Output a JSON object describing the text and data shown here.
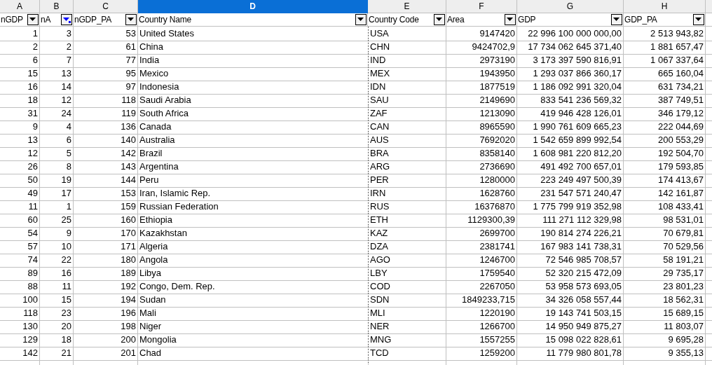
{
  "column_letters": [
    {
      "label": "A",
      "selected": false
    },
    {
      "label": "B",
      "selected": false
    },
    {
      "label": "C",
      "selected": false
    },
    {
      "label": "D",
      "selected": true
    },
    {
      "label": "E",
      "selected": false
    },
    {
      "label": "F",
      "selected": false
    },
    {
      "label": "G",
      "selected": false
    },
    {
      "label": "H",
      "selected": false
    }
  ],
  "header_row": [
    {
      "label": "nGDP",
      "filter_active": false,
      "kind": "number"
    },
    {
      "label": "nA",
      "filter_active": true,
      "kind": "number"
    },
    {
      "label": "nGDP_PA",
      "filter_active": false,
      "kind": "number"
    },
    {
      "label": "Country Name",
      "filter_active": false,
      "kind": "text"
    },
    {
      "label": "Country Code",
      "filter_active": false,
      "kind": "text"
    },
    {
      "label": "Area",
      "filter_active": false,
      "kind": "number"
    },
    {
      "label": "GDP",
      "filter_active": false,
      "kind": "number"
    },
    {
      "label": "GDP_PA",
      "filter_active": false,
      "kind": "number"
    }
  ],
  "rows": [
    [
      "1",
      "3",
      "53",
      "United States",
      "USA",
      "9147420",
      "22 996 100 000 000,00",
      "2 513 943,82"
    ],
    [
      "2",
      "2",
      "61",
      "China",
      "CHN",
      "9424702,9",
      "17 734 062 645 371,40",
      "1 881 657,47"
    ],
    [
      "6",
      "7",
      "77",
      "India",
      "IND",
      "2973190",
      "3 173 397 590 816,91",
      "1 067 337,64"
    ],
    [
      "15",
      "13",
      "95",
      "Mexico",
      "MEX",
      "1943950",
      "1 293 037 866 360,17",
      "665 160,04"
    ],
    [
      "16",
      "14",
      "97",
      "Indonesia",
      "IDN",
      "1877519",
      "1 186 092 991 320,04",
      "631 734,21"
    ],
    [
      "18",
      "12",
      "118",
      "Saudi Arabia",
      "SAU",
      "2149690",
      "833 541 236 569,32",
      "387 749,51"
    ],
    [
      "31",
      "24",
      "119",
      "South Africa",
      "ZAF",
      "1213090",
      "419 946 428 126,01",
      "346 179,12"
    ],
    [
      "9",
      "4",
      "136",
      "Canada",
      "CAN",
      "8965590",
      "1 990 761 609 665,23",
      "222 044,69"
    ],
    [
      "13",
      "6",
      "140",
      "Australia",
      "AUS",
      "7692020",
      "1 542 659 899 992,54",
      "200 553,29"
    ],
    [
      "12",
      "5",
      "142",
      "Brazil",
      "BRA",
      "8358140",
      "1 608 981 220 812,20",
      "192 504,70"
    ],
    [
      "26",
      "8",
      "143",
      "Argentina",
      "ARG",
      "2736690",
      "491 492 700 657,01",
      "179 593,85"
    ],
    [
      "50",
      "19",
      "144",
      "Peru",
      "PER",
      "1280000",
      "223 249 497 500,39",
      "174 413,67"
    ],
    [
      "49",
      "17",
      "153",
      "Iran, Islamic Rep.",
      "IRN",
      "1628760",
      "231 547 571 240,47",
      "142 161,87"
    ],
    [
      "11",
      "1",
      "159",
      "Russian Federation",
      "RUS",
      "16376870",
      "1 775 799 919 352,98",
      "108 433,41"
    ],
    [
      "60",
      "25",
      "160",
      "Ethiopia",
      "ETH",
      "1129300,39",
      "111 271 112 329,98",
      "98 531,01"
    ],
    [
      "54",
      "9",
      "170",
      "Kazakhstan",
      "KAZ",
      "2699700",
      "190 814 274 226,21",
      "70 679,81"
    ],
    [
      "57",
      "10",
      "171",
      "Algeria",
      "DZA",
      "2381741",
      "167 983 141 738,31",
      "70 529,56"
    ],
    [
      "74",
      "22",
      "180",
      "Angola",
      "AGO",
      "1246700",
      "72 546 985 708,57",
      "58 191,21"
    ],
    [
      "89",
      "16",
      "189",
      "Libya",
      "LBY",
      "1759540",
      "52 320 215 472,09",
      "29 735,17"
    ],
    [
      "88",
      "11",
      "192",
      "Congo, Dem. Rep.",
      "COD",
      "2267050",
      "53 958 573 693,05",
      "23 801,23"
    ],
    [
      "100",
      "15",
      "194",
      "Sudan",
      "SDN",
      "1849233,715",
      "34 326 058 557,44",
      "18 562,31"
    ],
    [
      "118",
      "23",
      "196",
      "Mali",
      "MLI",
      "1220190",
      "19 143 741 503,15",
      "15 689,15"
    ],
    [
      "130",
      "20",
      "198",
      "Niger",
      "NER",
      "1266700",
      "14 950 949 875,27",
      "11 803,07"
    ],
    [
      "129",
      "18",
      "200",
      "Mongolia",
      "MNG",
      "1557255",
      "15 098 022 828,61",
      "9 695,28"
    ],
    [
      "142",
      "21",
      "201",
      "Chad",
      "TCD",
      "1259200",
      "11 779 980 801,78",
      "9 355,13"
    ]
  ]
}
